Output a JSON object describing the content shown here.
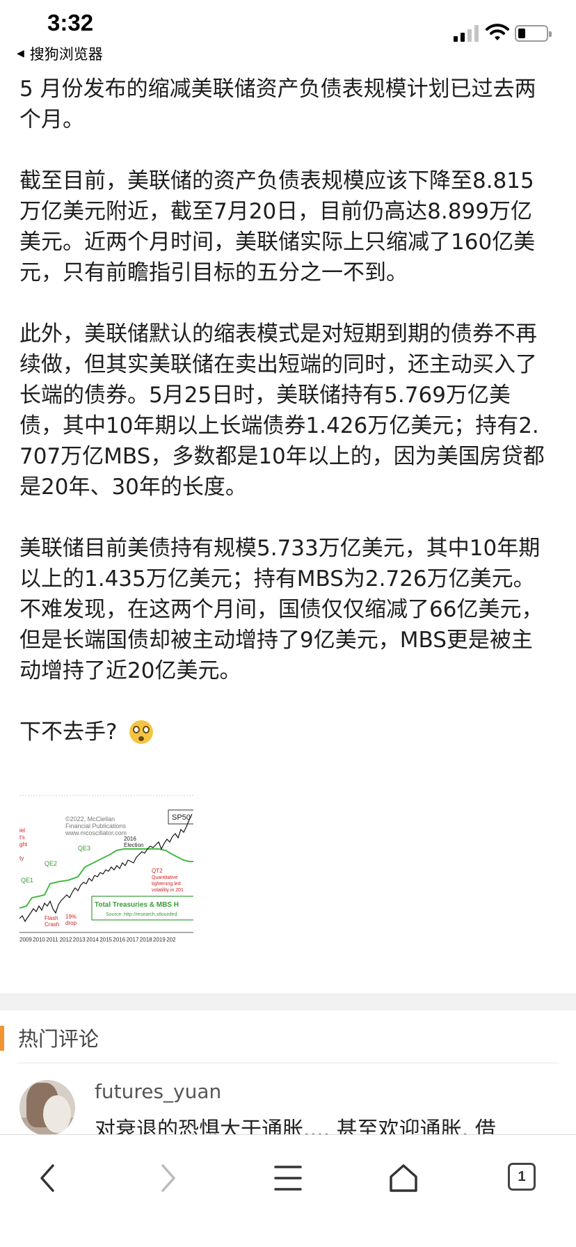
{
  "status_bar": {
    "time": "3:32",
    "back_app": "搜狗浏览器",
    "icons": [
      "cellular-signal-icon",
      "wifi-icon",
      "battery-icon"
    ]
  },
  "article": {
    "paragraphs": [
      "5 月份发布的缩减美联储资产负债表规模计划已过去两个月。",
      "截至目前，美联储的资产负债表规模应该下降至8.815万亿美元附近，截至7月20日，目前仍高达8.899万亿美元。近两个月时间，美联储实际上只缩减了160亿美元，只有前瞻指引目标的五分之一不到。",
      "此外，美联储默认的缩表模式是对短期到期的债券不再续做，但其实美联储在卖出短端的同时，还主动买入了长端的债券。5月25日时，美联储持有5.769万亿美债，其中10年期以上长端债券1.426万亿美元；持有2.707万亿MBS，多数都是10年以上的，因为美国房贷都是20年、30年的长度。",
      "美联储目前美债持有规模5.733万亿美元，其中10年期以上的1.435万亿美元；持有MBS为2.726万亿美元。不难发现，在这两个月间，国债仅仅缩减了66亿美元，但是长端国债却被主动增持了9亿美元，MBS更是被主动增持了近20亿美元。"
    ],
    "question": "下不去手?",
    "emoji": "flushed-face-icon"
  },
  "chart_thumb": {
    "copyright_lines": [
      "©2022, McClellan",
      "Financial Publications",
      "www.mcoscillator.com"
    ],
    "ticker_label": "SP50",
    "left_cut_labels": [
      "iel",
      "t's",
      "ght",
      "ty"
    ],
    "annotations": {
      "qe1": "QE1",
      "qe2": "QE2",
      "qe3": "QE3",
      "election_year": "2016",
      "election": "Election",
      "qt2_lines": [
        "QT2",
        "Quantitative",
        "tightening led",
        "volatility in 201"
      ],
      "flash_lines": [
        "Flash",
        "Crash"
      ],
      "drop_lines": [
        "19%",
        "drop"
      ]
    },
    "legend_title": "Total Treasuries & MBS H",
    "legend_source": "Source: http://research.stlouisfed.",
    "x_ticks": [
      "2009",
      "2010",
      "2011",
      "2012",
      "2013",
      "2014",
      "2015",
      "2016",
      "2017",
      "2018",
      "2019",
      "202"
    ],
    "colors": {
      "price": "#111111",
      "holdings": "#44bb44",
      "annotation_red": "#cc2222"
    }
  },
  "comments": {
    "header": "热门评论",
    "items": [
      {
        "user": "futures_yuan",
        "text": "对衰退的恐惧大于通胀.... 甚至欢迎通胀, 借"
      }
    ]
  },
  "toolbar": {
    "tabs_count": "1",
    "icons": [
      "back-arrow-icon",
      "forward-arrow-icon",
      "menu-icon",
      "home-icon",
      "tabs-icon"
    ]
  }
}
